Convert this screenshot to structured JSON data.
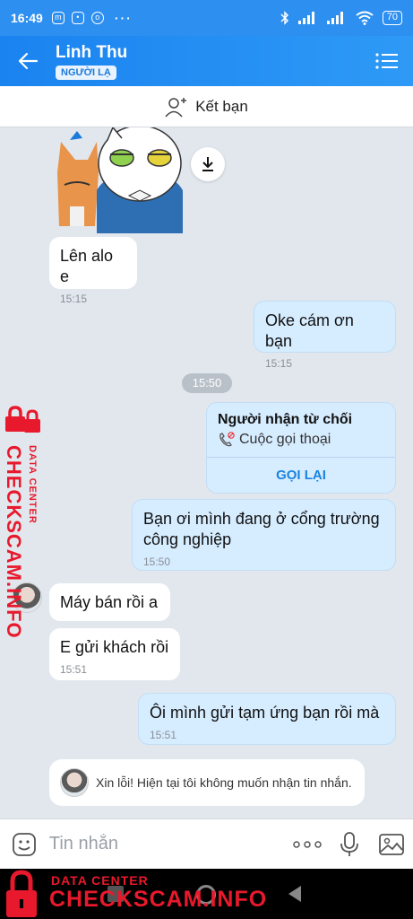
{
  "status_bar": {
    "time": "16:49",
    "more": "···",
    "battery": "70"
  },
  "header": {
    "name": "Linh Thu",
    "badge": "NGƯỜI LẠ"
  },
  "add_friend": {
    "label": "Kết bạn"
  },
  "messages": {
    "m1": {
      "text": "Lên alo e",
      "time": "15:15"
    },
    "m2": {
      "text": "Oke cám ơn bạn",
      "time": "15:15"
    },
    "divider_time": "15:50",
    "call": {
      "title": "Người nhận từ chối",
      "subtitle": "Cuộc gọi thoại",
      "action": "GỌI LẠI"
    },
    "m3": {
      "line1": "Bạn ơi mình đang ở cổng trường",
      "line2": "công nghiệp",
      "time": "15:50"
    },
    "m4": {
      "text": "Máy bán rồi a"
    },
    "m5": {
      "text": "E gửi khách rồi",
      "time": "15:51"
    },
    "m6": {
      "text": "Ôi mình gửi tạm ứng bạn rồi mà",
      "time": "15:51"
    },
    "notice": "Xin lỗi! Hiện tại tôi không muốn nhận tin nhắn."
  },
  "input": {
    "placeholder": "Tin nhắn"
  },
  "watermark": {
    "small": "DATA CENTER",
    "large": "CHECKSCAM.INFO"
  },
  "colors": {
    "primary": "#1a83f0",
    "my_bubble": "#d6ecff",
    "watermark": "#e8192c"
  }
}
